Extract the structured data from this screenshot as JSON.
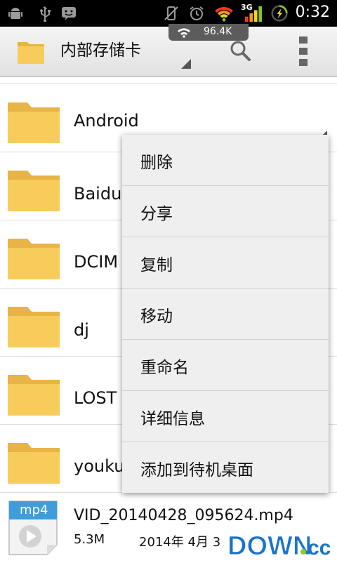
{
  "status_bar": {
    "time": "0:32",
    "network_speed": "96.4K",
    "network_type": "3G",
    "icons": [
      "android-debug-icon",
      "usb-icon",
      "notification-icon",
      "mute-icon",
      "alarm-icon",
      "wifi-icon",
      "signal-icon",
      "battery-icon"
    ]
  },
  "action_bar": {
    "title": "内部存储卡",
    "icons": [
      "folder-icon",
      "search-icon",
      "overflow-menu-icon"
    ]
  },
  "file_list": {
    "folders": [
      {
        "name": "Android"
      },
      {
        "name": "Baidu"
      },
      {
        "name": "DCIM"
      },
      {
        "name": "dj"
      },
      {
        "name": "LOST"
      },
      {
        "name": "youku"
      }
    ],
    "file": {
      "name": "VID_20140428_095624.mp4",
      "size": "5.3M",
      "date": "2014年 4月 3",
      "thumb_label": "mp4"
    }
  },
  "context_menu": {
    "items": [
      {
        "label": "删除"
      },
      {
        "label": "分享"
      },
      {
        "label": "复制"
      },
      {
        "label": "移动"
      },
      {
        "label": "重命名"
      },
      {
        "label": "详细信息"
      },
      {
        "label": "添加到待机桌面"
      }
    ]
  },
  "watermark": {
    "text": "DOWN.cc"
  },
  "colors": {
    "folder": "#f5c451",
    "accent_green": "#8ccc2a",
    "watermark_blue": "#1a74c8"
  }
}
